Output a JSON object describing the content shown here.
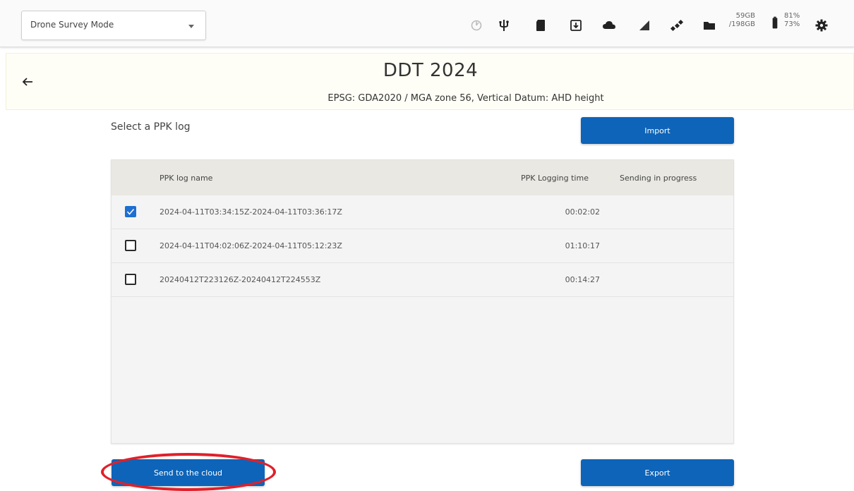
{
  "toolbar": {
    "mode_select": "Drone Survey Mode",
    "storage_used": "59GB",
    "storage_total": "/198GB",
    "battery_top": "81%",
    "battery_bottom": "73%"
  },
  "header": {
    "title": "DDT 2024",
    "subtitle": "EPSG: GDA2020 / MGA zone 56, Vertical Datum: AHD height"
  },
  "main": {
    "select_label": "Select a PPK log",
    "import_label": "Import",
    "send_label": "Send to the cloud",
    "export_label": "Export"
  },
  "table": {
    "columns": [
      "PPK log name",
      "PPK Logging time",
      "Sending in progress"
    ],
    "rows": [
      {
        "name": "2024-04-11T03:34:15Z-2024-04-11T03:36:17Z",
        "time": "00:02:02",
        "checked": true
      },
      {
        "name": "2024-04-11T04:02:06Z-2024-04-11T05:12:23Z",
        "time": "01:10:17",
        "checked": false
      },
      {
        "name": "20240412T223126Z-20240412T224553Z",
        "time": "00:14:27",
        "checked": false
      }
    ]
  },
  "colors": {
    "primary": "#0d64b8",
    "checkbox_checked": "#1e6fd0",
    "highlight": "#e0202a"
  }
}
